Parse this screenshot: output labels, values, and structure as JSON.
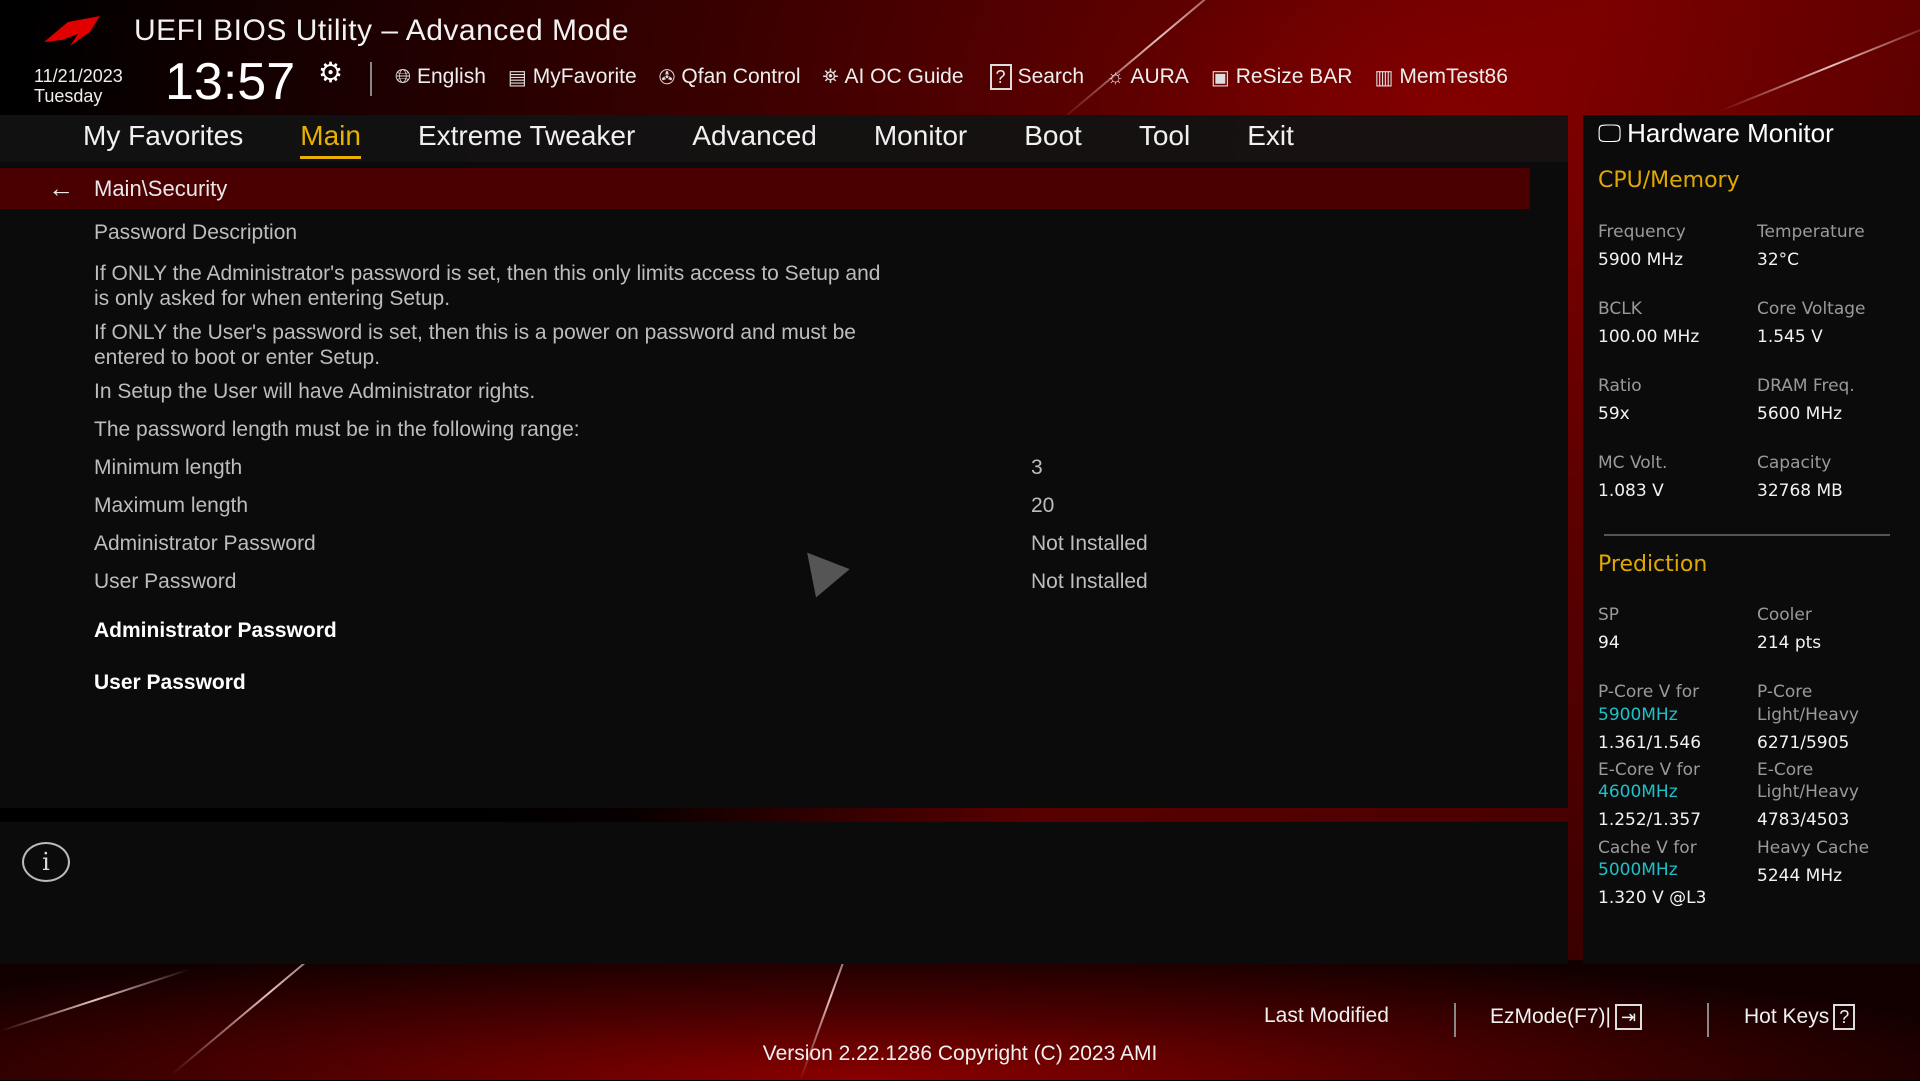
{
  "header": {
    "title": "UEFI BIOS Utility – Advanced Mode",
    "date": "11/21/2023",
    "day": "Tuesday",
    "time": "13:57"
  },
  "toolbar": [
    {
      "icon": "globe-icon",
      "label": "English"
    },
    {
      "icon": "favorite-list-icon",
      "label": "MyFavorite"
    },
    {
      "icon": "fan-icon",
      "label": "Qfan Control"
    },
    {
      "icon": "chip-icon",
      "label": "AI OC Guide"
    },
    {
      "icon": "question-box-icon",
      "label": "Search"
    },
    {
      "icon": "aura-light-icon",
      "label": "AURA"
    },
    {
      "icon": "gpu-card-icon",
      "label": "ReSize BAR"
    },
    {
      "icon": "memory-icon",
      "label": "MemTest86"
    }
  ],
  "tabs": [
    "My Favorites",
    "Main",
    "Extreme Tweaker",
    "Advanced",
    "Monitor",
    "Boot",
    "Tool",
    "Exit"
  ],
  "active_tab": "Main",
  "breadcrumb": "Main\\Security",
  "content": {
    "desc_title": "Password Description",
    "desc": [
      "If ONLY the Administrator's password is set, then this only limits access to Setup and",
      "is only asked for when entering Setup.",
      "If ONLY the User's password is set, then this is a power on password and must be",
      "entered to boot or enter Setup.",
      "In Setup the User will have Administrator rights.",
      "The password length must be in the following range:"
    ],
    "settings": [
      {
        "label": "Minimum length",
        "value": "3"
      },
      {
        "label": "Maximum length",
        "value": "20"
      },
      {
        "label": "Administrator Password",
        "value": "Not Installed"
      },
      {
        "label": "User Password",
        "value": "Not Installed"
      }
    ],
    "actions": [
      "Administrator Password",
      "User Password"
    ]
  },
  "monitor": {
    "title": "Hardware Monitor",
    "cpu_title": "CPU/Memory",
    "cpu": [
      {
        "label": "Frequency",
        "value": "5900 MHz"
      },
      {
        "label": "Temperature",
        "value": "32°C"
      },
      {
        "label": "BCLK",
        "value": "100.00 MHz"
      },
      {
        "label": "Core Voltage",
        "value": "1.545 V"
      },
      {
        "label": "Ratio",
        "value": "59x"
      },
      {
        "label": "DRAM Freq.",
        "value": "5600 MHz"
      },
      {
        "label": "MC Volt.",
        "value": "1.083 V"
      },
      {
        "label": "Capacity",
        "value": "32768 MB"
      }
    ],
    "pred_title": "Prediction",
    "sp_label": "SP",
    "sp": "94",
    "cooler_label": "Cooler",
    "cooler": "214 pts",
    "pcore_label": "P-Core V for",
    "pcore_freq": "5900MHz",
    "pcore_v": "1.361/1.546",
    "pcore_lh_label1": "P-Core",
    "pcore_lh_label2": "Light/Heavy",
    "pcore_lh": "6271/5905",
    "ecore_label": "E-Core V for",
    "ecore_freq": "4600MHz",
    "ecore_v": "1.252/1.357",
    "ecore_lh_label1": "E-Core",
    "ecore_lh_label2": "Light/Heavy",
    "ecore_lh": "4783/4503",
    "cache_label": "Cache V for",
    "cache_freq": "5000MHz",
    "cache_v": "1.320 V @L3",
    "hcache_label": "Heavy Cache",
    "hcache": "5244 MHz"
  },
  "footer": {
    "last_modified": "Last Modified",
    "ezmode": "EzMode(F7)|",
    "hotkeys": "Hot Keys",
    "hotkeys_icon": "?",
    "version": "Version 2.22.1286 Copyright (C) 2023 AMI"
  }
}
